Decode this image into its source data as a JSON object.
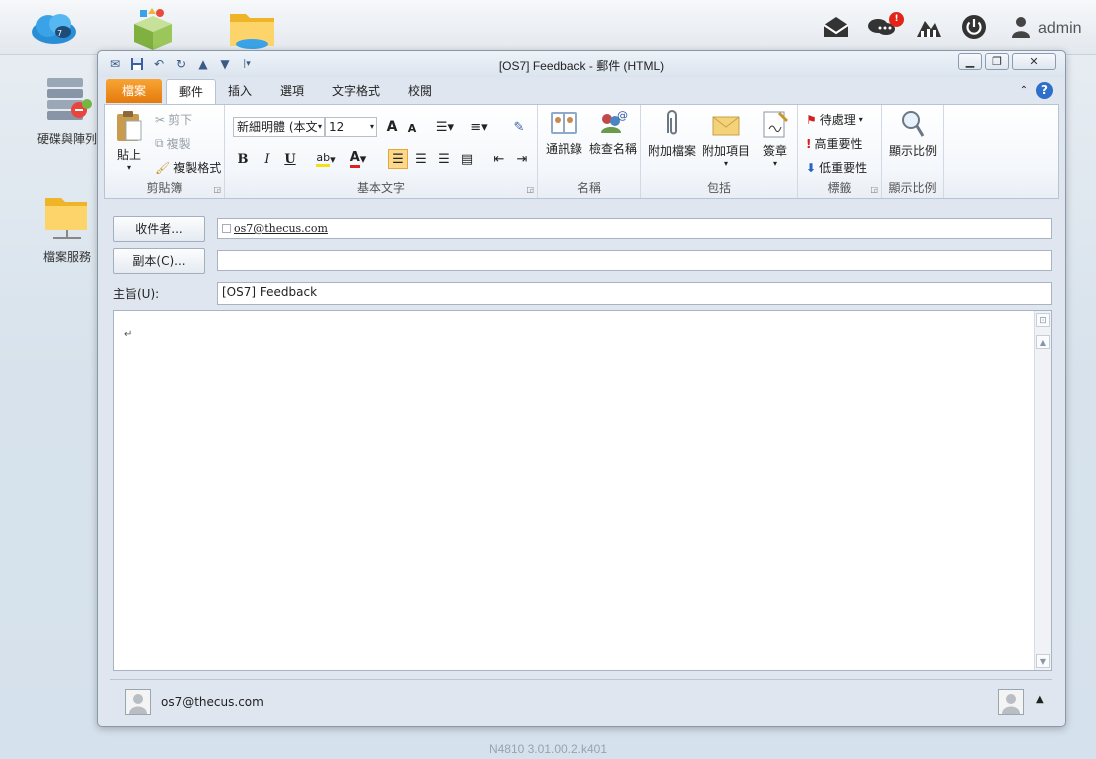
{
  "topbar": {
    "apps": [
      "cloud-icon",
      "package-icon",
      "folder-icon"
    ],
    "notification_count": "!",
    "user": "admin"
  },
  "desktop": {
    "icons": [
      {
        "label": "硬碟與陣列"
      },
      {
        "label": "檔案服務"
      }
    ]
  },
  "window": {
    "title": "[OS7] Feedback - 郵件 (HTML)",
    "tabs": {
      "file": "檔案",
      "message": "郵件",
      "insert": "插入",
      "options": "選項",
      "format": "文字格式",
      "review": "校閱"
    },
    "ribbon": {
      "clipboard": {
        "label": "剪貼簿",
        "paste": "貼上",
        "cut": "剪下",
        "copy": "複製",
        "format_painter": "複製格式"
      },
      "basic_text": {
        "label": "基本文字",
        "font": "新細明體 (本文",
        "size": "12",
        "bold": "B",
        "italic": "I",
        "underline": "U",
        "grow": "A",
        "shrink": "A"
      },
      "names": {
        "label": "名稱",
        "address_book": "通訊錄",
        "check_names": "檢查名稱"
      },
      "include": {
        "label": "包括",
        "attach_file": "附加檔案",
        "attach_item": "附加項目",
        "signature": "簽章"
      },
      "tags": {
        "label": "標籤",
        "follow_up": "待處理",
        "high_importance": "高重要性",
        "low_importance": "低重要性"
      },
      "zoom": {
        "label": "顯示比例",
        "zoom": "顯示比例"
      }
    },
    "fields": {
      "to_button": "收件者...",
      "to_value": "os7@thecus.com",
      "cc_button": "副本(C)...",
      "cc_value": "",
      "subject_label": "主旨(U):",
      "subject_value": "[OS7] Feedback"
    },
    "body": {
      "paragraph_mark": "↵"
    },
    "footer": {
      "sender": "os7@thecus.com"
    }
  },
  "version": "N4810   3.01.00.2.k401"
}
